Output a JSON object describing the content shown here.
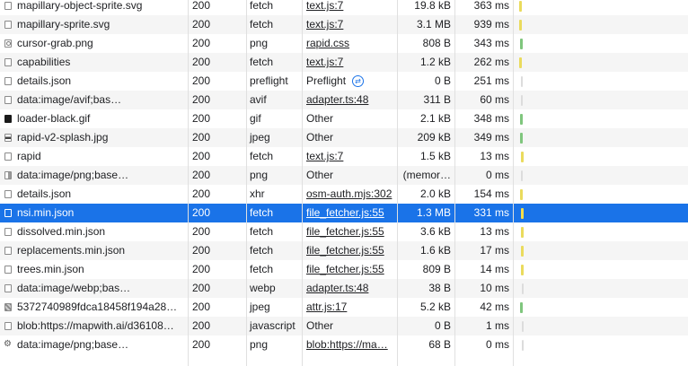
{
  "colors": {
    "selected_bg": "#1a73e8",
    "zebra_bg": "#f5f5f5",
    "waiting_yellow": "#eadb5d",
    "receiving_green": "#7fc67d",
    "cached_grey": "#dcdcdc"
  },
  "rows": [
    {
      "name": "mapillary-object-sprite.svg",
      "status": "200",
      "type": "fetch",
      "initiator": "text.js:7",
      "initiator_link": true,
      "size": "19.8 kB",
      "time": "363 ms",
      "icon": "file-icon",
      "bar": "yellow"
    },
    {
      "name": "mapillary-sprite.svg",
      "status": "200",
      "type": "fetch",
      "initiator": "text.js:7",
      "initiator_link": true,
      "size": "3.1 MB",
      "time": "939 ms",
      "icon": "file-icon",
      "bar": "yellow"
    },
    {
      "name": "cursor-grab.png",
      "status": "200",
      "type": "png",
      "initiator": "rapid.css",
      "initiator_link": true,
      "size": "808 B",
      "time": "343 ms",
      "icon": "cursor-image-icon",
      "bar": "green"
    },
    {
      "name": "capabilities",
      "status": "200",
      "type": "fetch",
      "initiator": "text.js:7",
      "initiator_link": true,
      "size": "1.2 kB",
      "time": "262 ms",
      "icon": "file-icon",
      "bar": "yellow"
    },
    {
      "name": "details.json",
      "status": "200",
      "type": "preflight",
      "initiator": "Preflight",
      "initiator_link": false,
      "preflight": true,
      "size": "0 B",
      "time": "251 ms",
      "icon": "file-icon",
      "bar": "grey"
    },
    {
      "name": "data:image/avif;bas…",
      "status": "200",
      "type": "avif",
      "initiator": "adapter.ts:48",
      "initiator_link": true,
      "size": "311 B",
      "time": "60 ms",
      "icon": "file-icon",
      "bar": "grey"
    },
    {
      "name": "loader-black.gif",
      "status": "200",
      "type": "gif",
      "initiator": "Other",
      "initiator_link": false,
      "size": "2.1 kB",
      "time": "348 ms",
      "icon": "black-image-icon",
      "bar": "green"
    },
    {
      "name": "rapid-v2-splash.jpg",
      "status": "200",
      "type": "jpeg",
      "initiator": "Other",
      "initiator_link": false,
      "size": "209 kB",
      "time": "349 ms",
      "icon": "splash-image-icon",
      "bar": "green"
    },
    {
      "name": "rapid",
      "status": "200",
      "type": "fetch",
      "initiator": "text.js:7",
      "initiator_link": true,
      "size": "1.5 kB",
      "time": "13 ms",
      "icon": "file-icon",
      "bar": "yellow"
    },
    {
      "name": "data:image/png;base…",
      "status": "200",
      "type": "png",
      "initiator": "Other",
      "initiator_link": false,
      "size": "(memor…",
      "time": "0 ms",
      "icon": "split-image-icon",
      "bar": "grey"
    },
    {
      "name": "details.json",
      "status": "200",
      "type": "xhr",
      "initiator": "osm-auth.mjs:302",
      "initiator_link": true,
      "size": "2.0 kB",
      "time": "154 ms",
      "icon": "file-icon",
      "bar": "yellow"
    },
    {
      "name": "nsi.min.json",
      "status": "200",
      "type": "fetch",
      "initiator": "file_fetcher.js:55",
      "initiator_link": true,
      "size": "1.3 MB",
      "time": "331 ms",
      "icon": "file-icon",
      "bar": "yellow",
      "selected": true
    },
    {
      "name": "dissolved.min.json",
      "status": "200",
      "type": "fetch",
      "initiator": "file_fetcher.js:55",
      "initiator_link": true,
      "size": "3.6 kB",
      "time": "13 ms",
      "icon": "file-icon",
      "bar": "yellow"
    },
    {
      "name": "replacements.min.json",
      "status": "200",
      "type": "fetch",
      "initiator": "file_fetcher.js:55",
      "initiator_link": true,
      "size": "1.6 kB",
      "time": "17 ms",
      "icon": "file-icon",
      "bar": "yellow"
    },
    {
      "name": "trees.min.json",
      "status": "200",
      "type": "fetch",
      "initiator": "file_fetcher.js:55",
      "initiator_link": true,
      "size": "809 B",
      "time": "14 ms",
      "icon": "file-icon",
      "bar": "yellow"
    },
    {
      "name": "data:image/webp;bas…",
      "status": "200",
      "type": "webp",
      "initiator": "adapter.ts:48",
      "initiator_link": true,
      "size": "38 B",
      "time": "10 ms",
      "icon": "file-icon",
      "bar": "grey"
    },
    {
      "name": "5372740989fdca18458f194a28…",
      "status": "200",
      "type": "jpeg",
      "initiator": "attr.js:17",
      "initiator_link": true,
      "size": "5.2 kB",
      "time": "42 ms",
      "icon": "photo-image-icon",
      "bar": "green"
    },
    {
      "name": "blob:https://mapwith.ai/d36108…",
      "status": "200",
      "type": "javascript",
      "initiator": "Other",
      "initiator_link": false,
      "size": "0 B",
      "time": "1 ms",
      "icon": "file-icon",
      "bar": "grey"
    },
    {
      "name": "data:image/png;base…",
      "status": "200",
      "type": "png",
      "initiator": "blob:https://ma…",
      "initiator_link": true,
      "size": "68 B",
      "time": "0 ms",
      "icon": "gear-icon",
      "bar": "grey"
    }
  ]
}
